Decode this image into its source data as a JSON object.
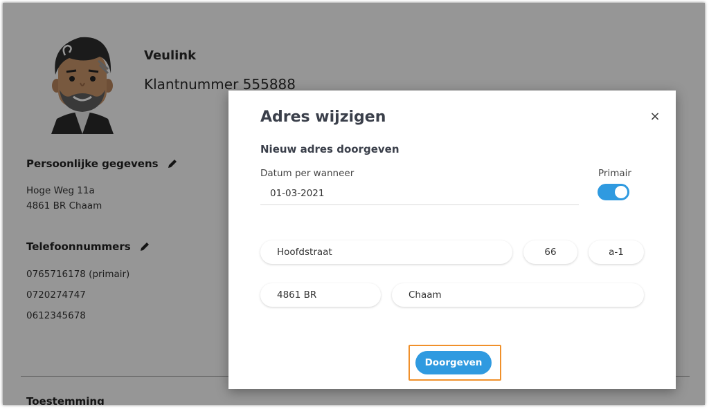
{
  "customer": {
    "name": "Veulink",
    "number_label": "Klantnummer 555888"
  },
  "personal": {
    "title": "Persoonlijke gegevens",
    "address_line1": "Hoge Weg 11a",
    "address_line2": "4861 BR Chaam"
  },
  "phones": {
    "title": "Telefoonnummers",
    "items": [
      "0765716178 (primair)",
      "0720274747",
      "0612345678"
    ]
  },
  "consent": {
    "title": "Toestemming"
  },
  "modal": {
    "title": "Adres wijzigen",
    "close_glyph": "×",
    "subtitle": "Nieuw adres doorgeven",
    "date_label": "Datum per wanneer",
    "date_value": "01-03-2021",
    "primary_label": "Primair",
    "primary_on": true,
    "street": "Hoofdstraat",
    "house_number": "66",
    "addition": "a-1",
    "postcode": "4861 BR",
    "city": "Chaam",
    "submit_label": "Doorgeven"
  },
  "colors": {
    "accent": "#2f9ae0",
    "highlight": "#f0902a",
    "overlay": "rgba(0,0,0,0.40)"
  },
  "icons": {
    "avatar": "avatar",
    "edit": "pencil-icon",
    "close": "close-icon"
  }
}
